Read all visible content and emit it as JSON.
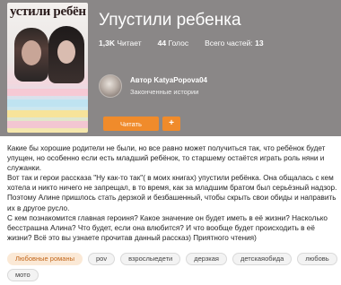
{
  "cover": {
    "text": "устили ребён"
  },
  "book": {
    "title": "Упустили ребенка"
  },
  "stats": [
    {
      "num": "1,3K",
      "label": "Читает"
    },
    {
      "num": "44",
      "label": "Голос"
    },
    {
      "label": "Всего частей:",
      "num": "13"
    }
  ],
  "author": {
    "name": "Автор KatyaPopova04",
    "status": "Законченные истории"
  },
  "actions": {
    "read_label": "Читать",
    "add_label": "+"
  },
  "description": [
    "Какие бы хорошие родители не были, но все равно может получиться так, что ребёнок  будет упущен, но особенно если есть младший ребёнок, то старшему остаётся играть роль няни и служанки.",
    "Вот так и герои рассказа \"Ну как-то так\"( в моих книгах) упустили ребёнка. Она общалась с кем хотела и никто ничего не запрещал, в то время, как за младшим братом был серьёзный надзор. Поэтому Алине пришлось стать дерзкой и безбашенный, чтобы скрыть свои обиды и направить их в другое русло.",
    "С кем познакомится главная героиня?  Какое значение он будет иметь в её жизни? Насколько бесстрашна Алина? Что будет, если она влюбится? И что вообще будет происходить в её жизни? Всё это вы узнаете прочитав данный рассказ) Приятного чтения)"
  ],
  "tags": [
    "Любовные романы",
    "pov",
    "взрослыедети",
    "дерзкая",
    "детскаяобида",
    "любовь",
    "мото"
  ],
  "colors": {
    "accent": "#f08b2b",
    "hero_bg": "#8a8787",
    "tag_highlight_bg": "#fbe9d6",
    "tag_highlight_text": "#c2661a"
  }
}
